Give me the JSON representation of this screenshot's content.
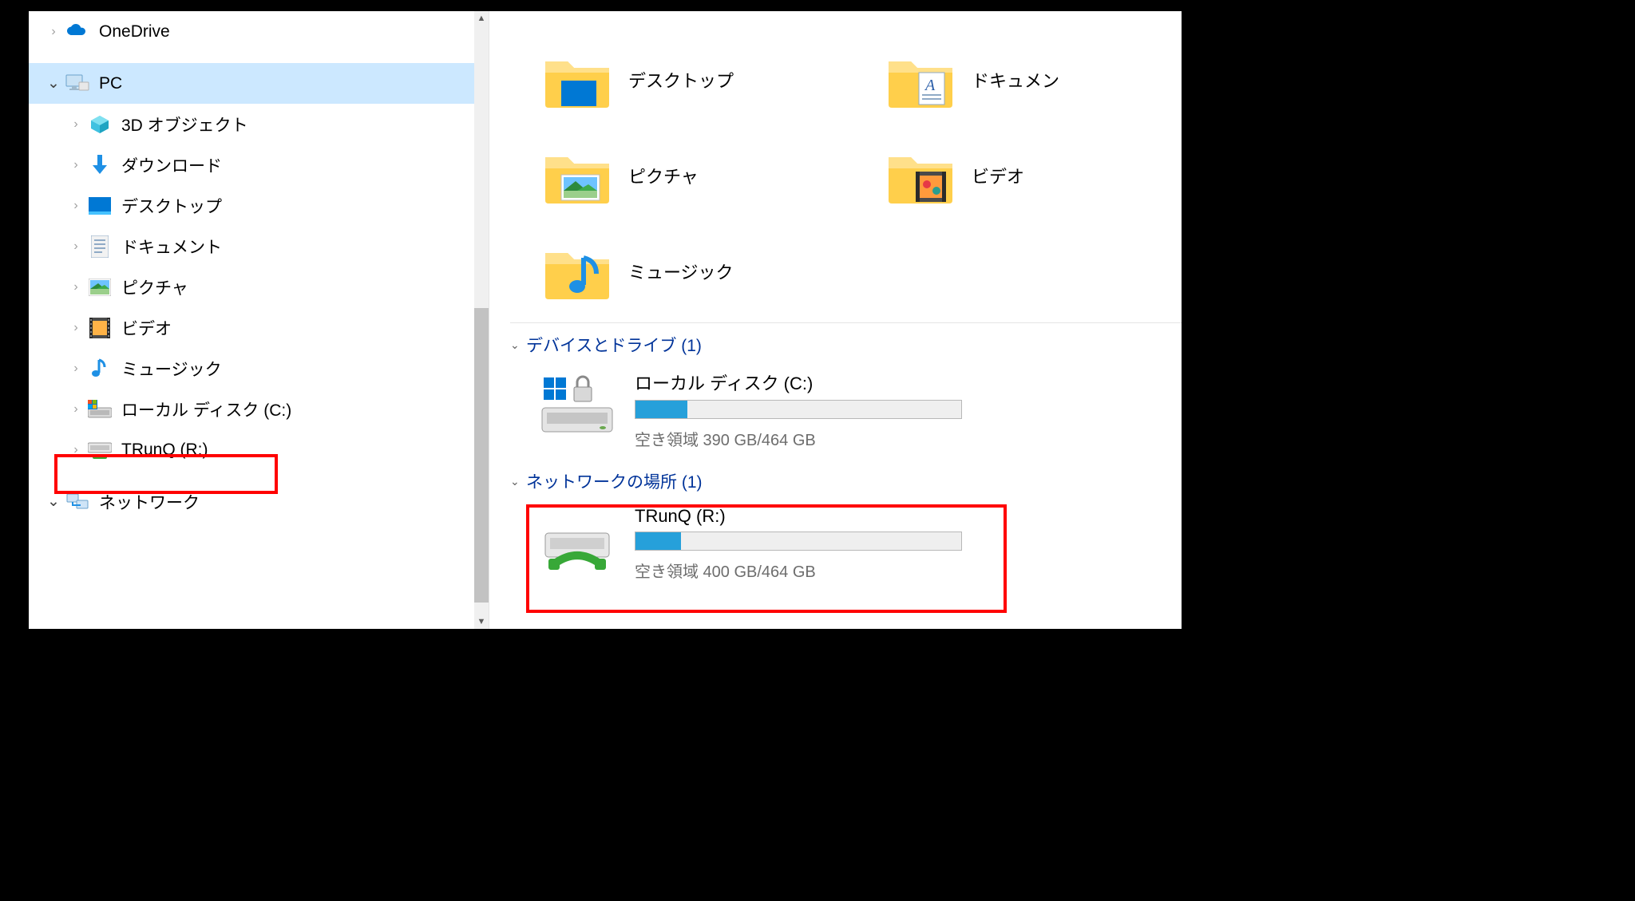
{
  "tree": {
    "onedrive": {
      "label": "OneDrive"
    },
    "pc": {
      "label": "PC"
    },
    "objects3d": {
      "label": "3D オブジェクト"
    },
    "downloads": {
      "label": "ダウンロード"
    },
    "desktop": {
      "label": "デスクトップ"
    },
    "documents": {
      "label": "ドキュメント"
    },
    "pictures": {
      "label": "ピクチャ"
    },
    "videos": {
      "label": "ビデオ"
    },
    "music": {
      "label": "ミュージック"
    },
    "cDrive": {
      "label": "ローカル ディスク (C:)"
    },
    "rDrive": {
      "label": "TRunQ (R:)"
    },
    "network": {
      "label": "ネットワーク"
    }
  },
  "folders": {
    "desktop": {
      "label": "デスクトップ"
    },
    "documents": {
      "label": "ドキュメン"
    },
    "pictures": {
      "label": "ピクチャ"
    },
    "videos": {
      "label": "ビデオ"
    },
    "music": {
      "label": "ミュージック"
    }
  },
  "groups": {
    "devices": {
      "title": "デバイスとドライブ (1)"
    },
    "network": {
      "title": "ネットワークの場所 (1)"
    }
  },
  "drives": {
    "c": {
      "name": "ローカル ディスク (C:)",
      "stats": "空き領域 390 GB/464 GB",
      "used_pct": 16
    },
    "r": {
      "name": "TRunQ (R:)",
      "stats": "空き領域 400 GB/464 GB",
      "used_pct": 14
    }
  }
}
